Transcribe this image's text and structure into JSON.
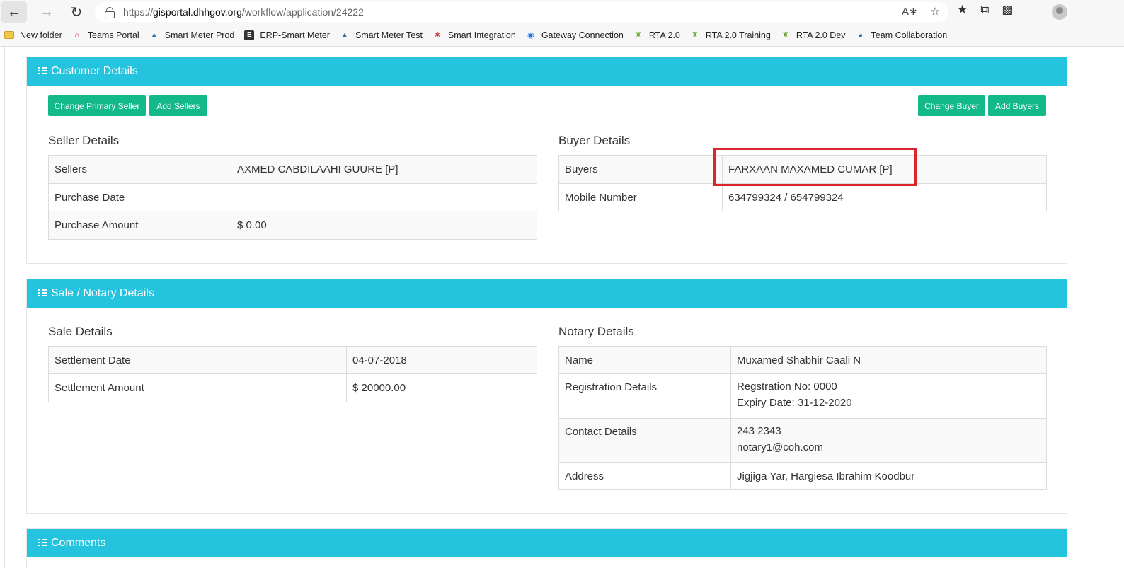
{
  "browser": {
    "url_proto": "https://",
    "url_host": "gisportal.dhhgov.org",
    "url_path": "/workflow/application/24222",
    "bookmarks": [
      {
        "label": "New folder",
        "icon": "folder-icon"
      },
      {
        "label": "Teams Portal",
        "icon": "teams-icon"
      },
      {
        "label": "Smart Meter Prod",
        "icon": "drop-icon"
      },
      {
        "label": "ERP-Smart Meter",
        "icon": "e-icon"
      },
      {
        "label": "Smart Meter Test",
        "icon": "drop-icon"
      },
      {
        "label": "Smart Integration",
        "icon": "huawei-icon"
      },
      {
        "label": "Gateway Connection",
        "icon": "gateway-icon"
      },
      {
        "label": "RTA 2.0",
        "icon": "rta-icon"
      },
      {
        "label": "RTA 2.0 Training",
        "icon": "rta-icon"
      },
      {
        "label": "RTA 2.0 Dev",
        "icon": "rta-icon"
      },
      {
        "label": "Team Collaboration",
        "icon": "collab-icon"
      }
    ]
  },
  "customer": {
    "header": "Customer Details",
    "buttons": {
      "change_primary_seller": "Change Primary Seller",
      "add_sellers": "Add Sellers",
      "change_buyer": "Change Buyer",
      "add_buyers": "Add Buyers"
    },
    "seller_title": "Seller Details",
    "seller_rows": [
      {
        "label": "Sellers",
        "value": "AXMED CABDILAAHI GUURE [P]"
      },
      {
        "label": "Purchase Date",
        "value": ""
      },
      {
        "label": "Purchase Amount",
        "value": "$ 0.00"
      }
    ],
    "buyer_title": "Buyer Details",
    "buyer_rows": [
      {
        "label": "Buyers",
        "value": "FARXAAN MAXAMED CUMAR [P]"
      },
      {
        "label": "Mobile Number",
        "value": "634799324 / 654799324"
      }
    ]
  },
  "sale": {
    "header": "Sale / Notary Details",
    "sale_title": "Sale Details",
    "sale_rows": [
      {
        "label": "Settlement Date",
        "value": "04-07-2018"
      },
      {
        "label": "Settlement Amount",
        "value": "$ 20000.00"
      }
    ],
    "notary_title": "Notary Details",
    "notary_rows": [
      {
        "label": "Name",
        "value": "Muxamed Shabhir Caali N"
      },
      {
        "label": "Registration Details",
        "value": "Regstration No: 0000",
        "value2": "Expiry Date: 31-12-2020"
      },
      {
        "label": "Contact Details",
        "value": "243 2343",
        "value2": "notary1@coh.com"
      },
      {
        "label": "Address",
        "value": "Jigjiga Yar, Hargiesa Ibrahim Koodbur"
      }
    ]
  },
  "comments": {
    "header": "Comments"
  }
}
